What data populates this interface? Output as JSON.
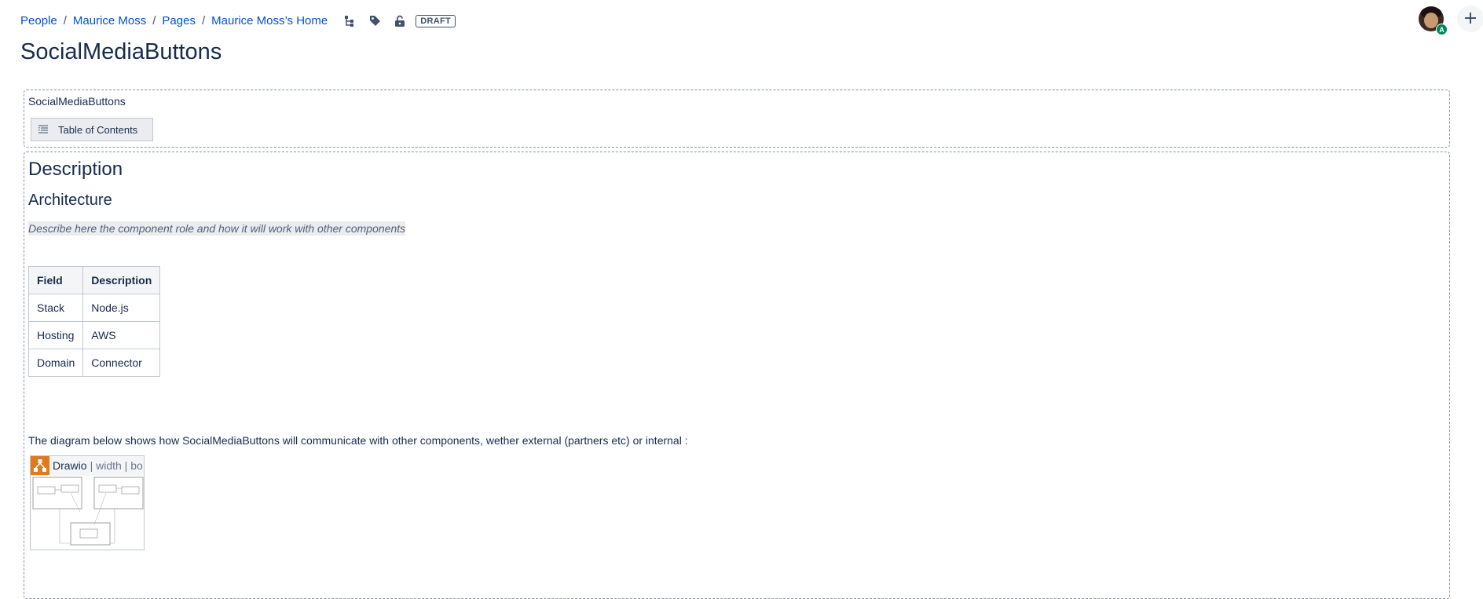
{
  "breadcrumbs": [
    "People",
    "Maurice Moss",
    "Pages",
    "Maurice Moss’s Home"
  ],
  "status_badge": "DRAFT",
  "avatar_badge": "A",
  "title": "SocialMediaButtons",
  "macro_panel": {
    "label": "SocialMediaButtons",
    "toc_button": "Table of Contents"
  },
  "content": {
    "heading1": "Description",
    "heading2": "Architecture",
    "placeholder": "Describe here the component role and how it will work with other components",
    "table": {
      "headers": [
        "Field",
        "Description"
      ],
      "rows": [
        [
          "Stack",
          "Node.js"
        ],
        [
          "Hosting",
          "AWS"
        ],
        [
          "Domain",
          "Connector"
        ]
      ]
    },
    "diagram_intro": "The diagram below shows how SocialMediaButtons will communicate with other components, wether external (partners etc) or internal :",
    "drawio": {
      "name": "Drawio",
      "params": "| width | bo"
    }
  },
  "colors": {
    "link": "#0052cc",
    "text": "#172b4d",
    "drawio_brand": "#e07a1d",
    "presence": "#00875a"
  },
  "icons": [
    "page-tree-icon",
    "tag-icon",
    "unlock-icon",
    "toc-icon",
    "drawio-logo-icon",
    "plus-icon"
  ]
}
